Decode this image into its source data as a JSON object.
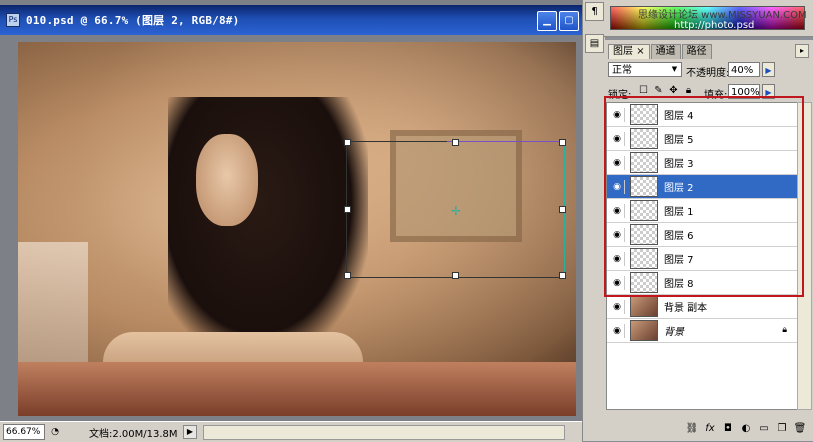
{
  "document": {
    "title": "010.psd @ 66.7% (图层 2, RGB/8#)",
    "zoom": "66.67%",
    "doc_size": "文档:2.00M/13.8M"
  },
  "top_panel": {
    "watermark_text": "思缘设计论坛 www.MISSYUAN.COM",
    "watermark_url": "http://photo.psd"
  },
  "layers_panel": {
    "tabs": [
      {
        "label": "图层",
        "close": "×",
        "active": true
      },
      {
        "label": "通道",
        "active": false
      },
      {
        "label": "路径",
        "active": false
      }
    ],
    "blend_mode": "正常",
    "opacity_label": "不透明度:",
    "opacity_value": "40%",
    "lock_label": "锁定:",
    "fill_label": "填充:",
    "fill_value": "100%",
    "layers": [
      {
        "name": "图层 4",
        "selected": false,
        "thumb": "transparent"
      },
      {
        "name": "图层 5",
        "selected": false,
        "thumb": "transparent"
      },
      {
        "name": "图层 3",
        "selected": false,
        "thumb": "transparent"
      },
      {
        "name": "图层 2",
        "selected": true,
        "thumb": "transparent"
      },
      {
        "name": "图层 1",
        "selected": false,
        "thumb": "transparent"
      },
      {
        "name": "图层 6",
        "selected": false,
        "thumb": "transparent"
      },
      {
        "name": "图层 7",
        "selected": false,
        "thumb": "transparent"
      },
      {
        "name": "图层 8",
        "selected": false,
        "thumb": "transparent"
      },
      {
        "name": "背景 副本",
        "selected": false,
        "thumb": "photo"
      },
      {
        "name": "背景",
        "selected": false,
        "thumb": "photo",
        "italic": true,
        "locked": true
      }
    ]
  },
  "icons": {
    "eye": "eye-icon",
    "lock": "lock-icon",
    "link": "link-icon",
    "fx": "fx-icon",
    "mask": "mask-icon",
    "adjust": "adjustment-icon",
    "group": "folder-icon",
    "new_layer": "new-layer-icon",
    "trash": "trash-icon"
  },
  "colors": {
    "selection": "#316ac5",
    "highlight_box": "#c0161e",
    "titlebar": "#0a246a"
  }
}
